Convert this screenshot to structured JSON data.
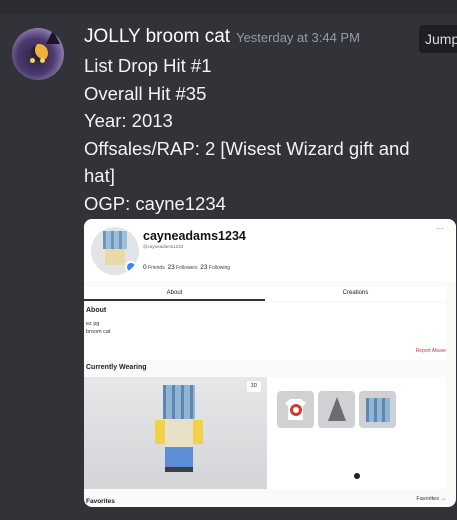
{
  "message": {
    "author": "JOLLY broom cat",
    "timestamp": "Yesterday at 3:44 PM",
    "jump_label": "Jump",
    "lines": [
      "List Drop Hit #1",
      "Overall Hit #35",
      "Year: 2013",
      "Offsales/RAP: 2 [Wisest Wizard gift and hat]",
      "OGP: cayne1234"
    ]
  },
  "embed": {
    "profile": {
      "display_name": "cayneadams1234",
      "handle": "@cayneadams1234",
      "friends_count": "0",
      "friends_label": "Friends",
      "followers_count": "23",
      "followers_label": "Followers",
      "following_count": "23",
      "following_label": "Following",
      "menu_glyph": "···"
    },
    "tabs": [
      "About",
      "Creations"
    ],
    "about": {
      "heading": "About",
      "line1": "ez pg",
      "line2": "broom cat",
      "report_label": "Report Abuse"
    },
    "currently_wearing": {
      "heading": "Currently Wearing",
      "toggle_3d": "3D",
      "items": [
        "tshirt-wreath-icon",
        "witch-hat-icon",
        "gift-box-icon"
      ]
    },
    "favorites": {
      "heading": "Favorites",
      "link_label": "Favorites →"
    }
  },
  "colors": {
    "background": "#313338",
    "author": "#ffffff",
    "timestamp": "#949ba4",
    "message_text": "#f2f3f5",
    "report_red": "#d03b3b"
  }
}
